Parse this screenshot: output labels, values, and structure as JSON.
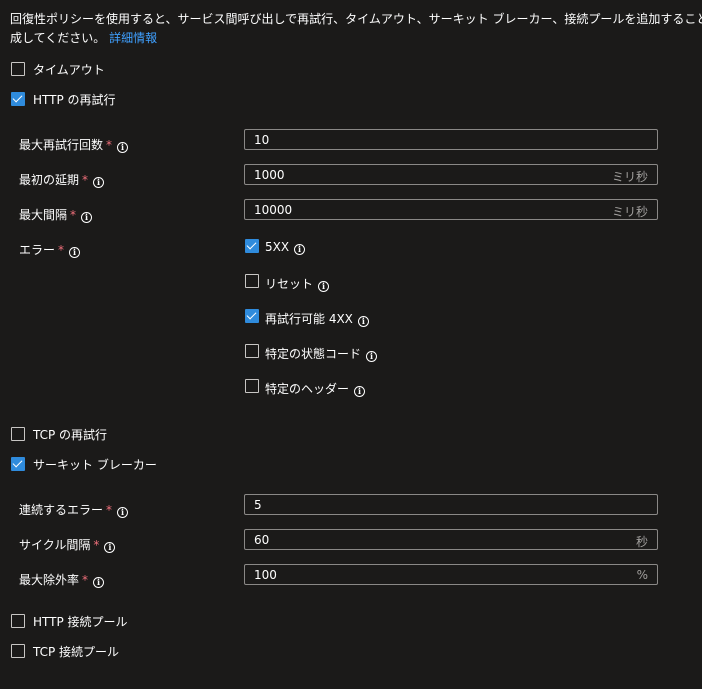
{
  "description": {
    "line1": "回復性ポリシーを使用すると、サービス間呼び出しで再試行、タイムアウト、サーキット ブレーカー、接続プールを追加することで",
    "line2": "成してください。",
    "link": "詳細情報"
  },
  "timeout": {
    "label": "タイムアウト",
    "checked": false
  },
  "http_retry": {
    "label": "HTTP の再試行",
    "checked": true
  },
  "http_fields": {
    "max_retries": {
      "label": "最大再試行回数",
      "value": "10"
    },
    "initial_delay": {
      "label": "最初の延期",
      "value": "1000",
      "unit": "ミリ秒"
    },
    "max_interval": {
      "label": "最大間隔",
      "value": "10000",
      "unit": "ミリ秒"
    },
    "errors": {
      "label": "エラー"
    }
  },
  "error_options": [
    {
      "label": "5XX",
      "checked": true
    },
    {
      "label": "リセット",
      "checked": false
    },
    {
      "label": "再試行可能 4XX",
      "checked": true
    },
    {
      "label": "特定の状態コード",
      "checked": false
    },
    {
      "label": "特定のヘッダー",
      "checked": false
    }
  ],
  "tcp_retry": {
    "label": "TCP の再試行",
    "checked": false
  },
  "circuit_breaker": {
    "label": "サーキット ブレーカー",
    "checked": true
  },
  "cb_fields": {
    "consecutive_errors": {
      "label": "連続するエラー",
      "value": "5"
    },
    "cycle_interval": {
      "label": "サイクル間隔",
      "value": "60",
      "unit": "秒"
    },
    "max_ejection": {
      "label": "最大除外率",
      "value": "100",
      "unit": "%"
    }
  },
  "http_pool": {
    "label": "HTTP 接続プール",
    "checked": false
  },
  "tcp_pool": {
    "label": "TCP 接続プール",
    "checked": false
  },
  "required_mark": "*",
  "info_glyph": "i",
  "colors": {
    "background": "#1b1a19",
    "accent": "#2f8bdc",
    "link": "#3fa0ff",
    "required": "#f1707b"
  }
}
